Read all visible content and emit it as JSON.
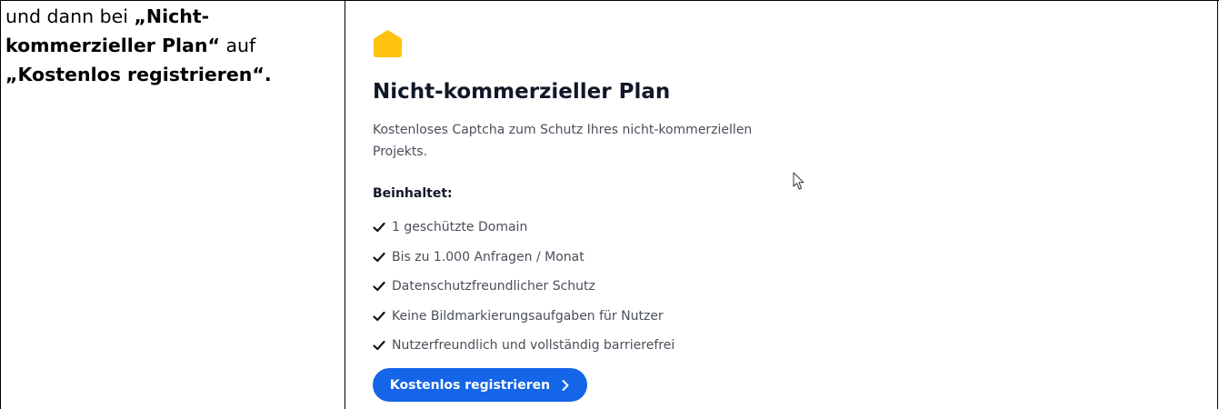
{
  "instruction": {
    "p1": "und dann bei ",
    "b1": "„Nicht-kommerzieller Plan“",
    "p2": " auf ",
    "b2": "„Kostenlos registrieren“."
  },
  "plan": {
    "icon": "house-icon",
    "title": "Nicht-kommerzieller Plan",
    "description": "Kostenloses Captcha zum Schutz Ihres nicht-kommerziellen Projekts.",
    "includes_heading": "Beinhaltet:",
    "features": [
      "1 geschützte Domain",
      "Bis zu 1.000 Anfragen / Monat",
      "Datenschutzfreundlicher Schutz",
      "Keine Bildmarkierungsaufgaben für Nutzer",
      "Nutzerfreundlich und vollständig barrierefrei"
    ],
    "button_label": "Kostenlos registrieren"
  },
  "colors": {
    "accent_yellow": "#ffc20e",
    "button_blue": "#1565e8",
    "title_text": "#101828",
    "body_text": "#4a4f5a"
  }
}
